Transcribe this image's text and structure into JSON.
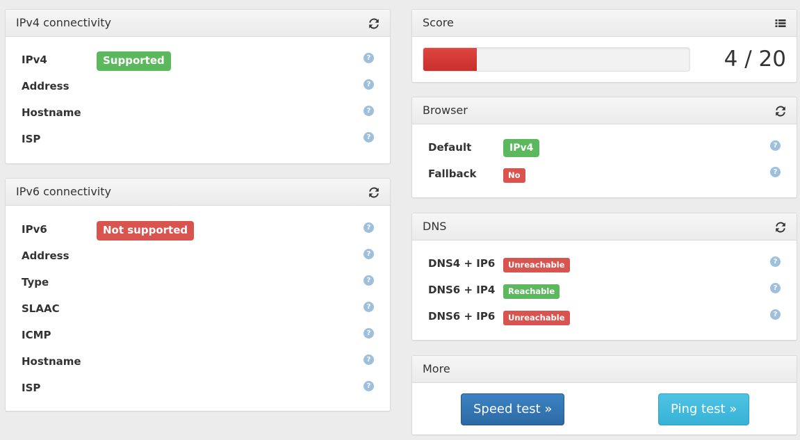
{
  "ipv4": {
    "title": "IPv4 connectivity",
    "rows": [
      {
        "label": "IPv4",
        "badge": "Supported"
      },
      {
        "label": "Address"
      },
      {
        "label": "Hostname"
      },
      {
        "label": "ISP"
      }
    ]
  },
  "ipv6": {
    "title": "IPv6 connectivity",
    "rows": [
      {
        "label": "IPv6",
        "badge": "Not supported"
      },
      {
        "label": "Address"
      },
      {
        "label": "Type"
      },
      {
        "label": "SLAAC"
      },
      {
        "label": "ICMP"
      },
      {
        "label": "Hostname"
      },
      {
        "label": "ISP"
      }
    ]
  },
  "score": {
    "title": "Score",
    "text": "4 / 20",
    "value": 4,
    "max": 20
  },
  "browser": {
    "title": "Browser",
    "rows": [
      {
        "label": "Default",
        "badge": "IPv4"
      },
      {
        "label": "Fallback",
        "badge": "No"
      }
    ]
  },
  "dns": {
    "title": "DNS",
    "rows": [
      {
        "label": "DNS4 + IP6",
        "badge": "Unreachable"
      },
      {
        "label": "DNS6 + IP4",
        "badge": "Reachable"
      },
      {
        "label": "DNS6 + IP6",
        "badge": "Unreachable"
      }
    ]
  },
  "more": {
    "title": "More",
    "speed_test_label": "Speed test »",
    "ping_test_label": "Ping test »"
  },
  "help_glyph": "?",
  "icons": {
    "refresh": "refresh-icon",
    "list": "list-icon",
    "help": "help-icon"
  },
  "colors": {
    "success": "#5cb85c",
    "danger": "#d9534f",
    "primary": "#337ab7",
    "info": "#5bc0de"
  }
}
